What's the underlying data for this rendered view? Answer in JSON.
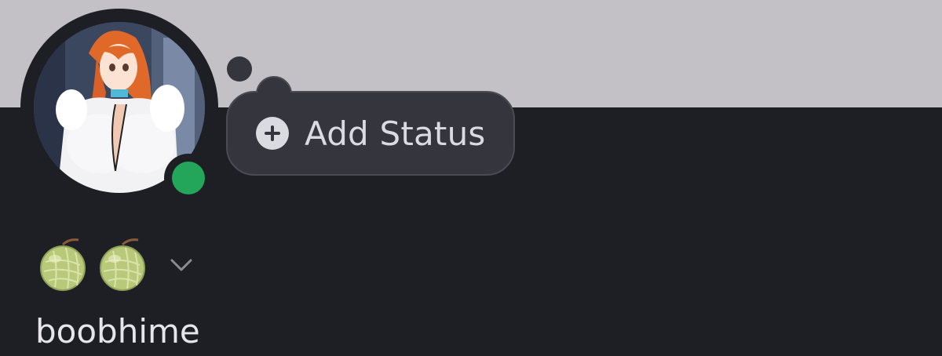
{
  "status": {
    "add_label": "Add Status",
    "icon": "plus-circle-icon"
  },
  "profile": {
    "username": "boobhime",
    "presence": "online",
    "presence_color": "#23a55a",
    "display_name_emoji": [
      "melon-icon",
      "melon-icon"
    ],
    "expand_icon": "chevron-down-icon"
  },
  "colors": {
    "banner": "#c3c1c5",
    "background": "#1e1f24",
    "bubble": "#34353d"
  }
}
